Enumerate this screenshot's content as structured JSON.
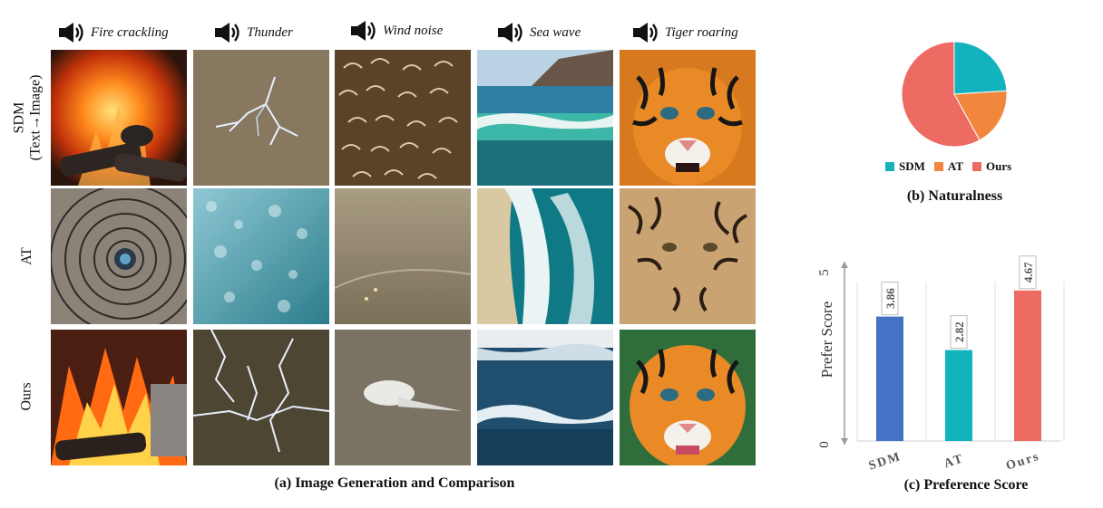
{
  "columns": [
    {
      "label": "Fire crackling"
    },
    {
      "label": "Thunder"
    },
    {
      "label": "Wind noise"
    },
    {
      "label": "Sea wave"
    },
    {
      "label": "Tiger roaring"
    }
  ],
  "rows": [
    {
      "label": "SDM",
      "sublabel": "(Text→Image)"
    },
    {
      "label": "AT",
      "sublabel": ""
    },
    {
      "label": "Ours",
      "sublabel": ""
    }
  ],
  "captions": {
    "a": "(a) Image Generation and Comparison",
    "b": "(b) Naturalness",
    "c": "(c) Preference Score"
  },
  "colors": {
    "sdm_pie": "#12b3bc",
    "at_pie": "#f0873d",
    "ours_pie": "#ee6b63",
    "sdm_bar": "#4472c4",
    "at_bar": "#12b3bc",
    "ours_bar": "#ee6b63"
  },
  "chart_data": [
    {
      "type": "pie",
      "title": "(b) Naturalness",
      "labels": [
        "SDM",
        "AT",
        "Ours"
      ],
      "values": [
        24,
        18,
        58
      ],
      "legend": "bottom"
    },
    {
      "type": "bar",
      "title": "(c) Preference Score",
      "categories": [
        "SDM",
        "AT",
        "Ours"
      ],
      "values": [
        3.86,
        2.82,
        4.67
      ],
      "ylabel": "Prefer Score",
      "ylim": [
        0,
        5
      ],
      "yticks": [
        "0",
        "5"
      ],
      "grid": false
    }
  ]
}
